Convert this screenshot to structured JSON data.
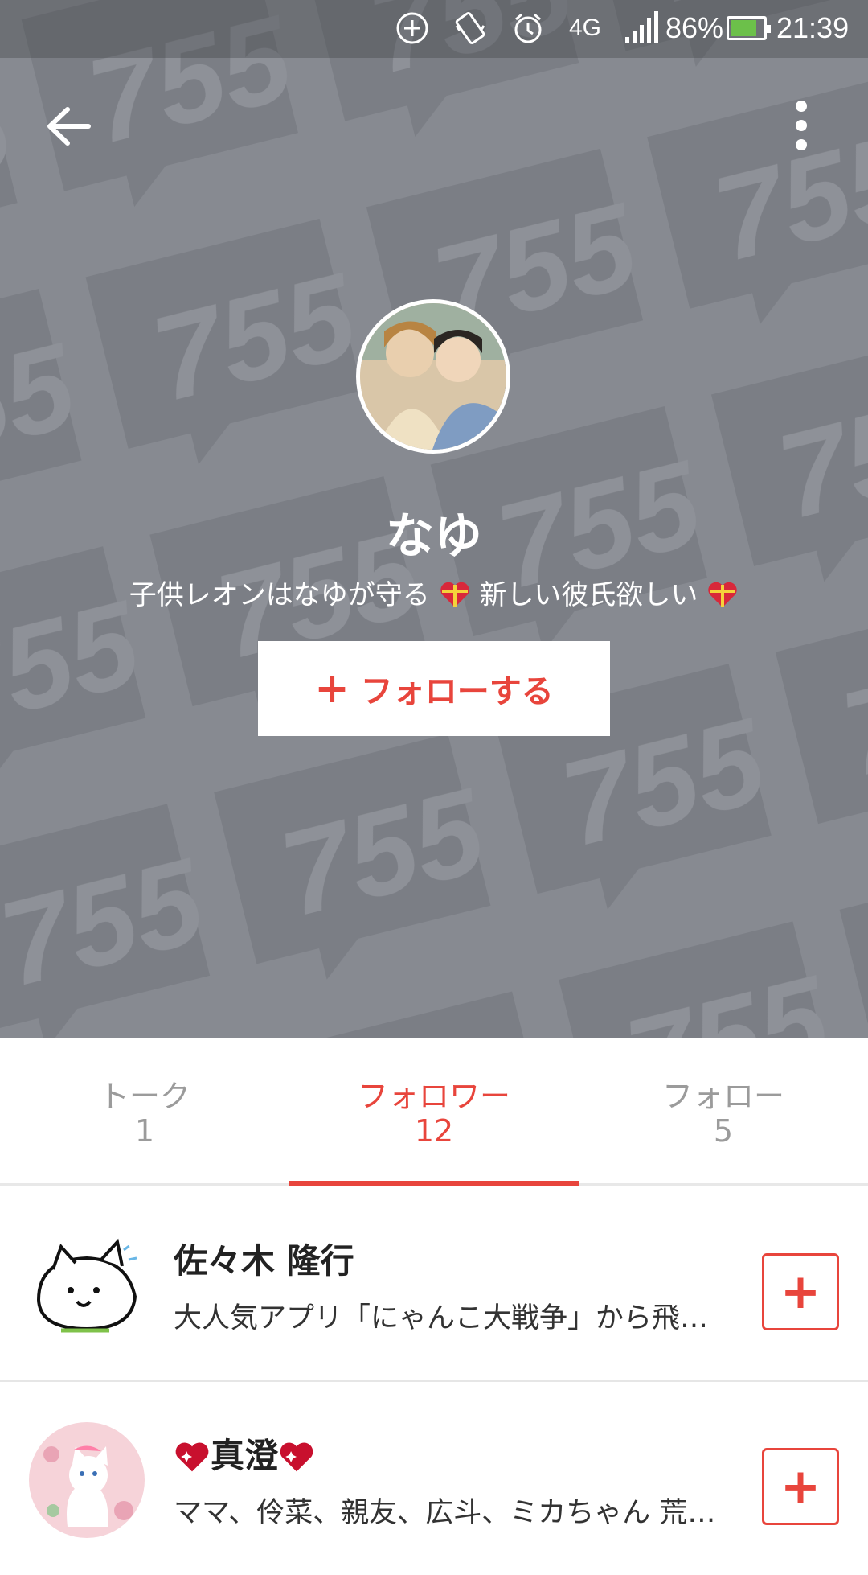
{
  "status_bar": {
    "network": "4G",
    "battery": "86%",
    "time": "21:39"
  },
  "profile": {
    "name": "なゆ",
    "bio_part1": "子供レオンはなゆが守る",
    "bio_part2": " 新しい彼氏欲しい",
    "follow_label": "フォローする",
    "follow_icon": "+"
  },
  "tabs": [
    {
      "label": "トーク",
      "count": "1",
      "active": false
    },
    {
      "label": "フォロワー",
      "count": "12",
      "active": true
    },
    {
      "label": "フォロー",
      "count": "5",
      "active": false
    }
  ],
  "followers": [
    {
      "name": "佐々木 隆行",
      "description": "大人気アプリ「にゃんこ大戦争」から飛…",
      "add_icon": "+"
    },
    {
      "name": "真澄",
      "description": "ママ、伶菜、親友、広斗、ミカちゃん 荒…",
      "add_icon": "+"
    }
  ],
  "colors": {
    "accent": "#e8453c",
    "cover_bg": "#878a91",
    "tab_inactive": "#9b9b9b"
  },
  "cover_watermark": "755"
}
